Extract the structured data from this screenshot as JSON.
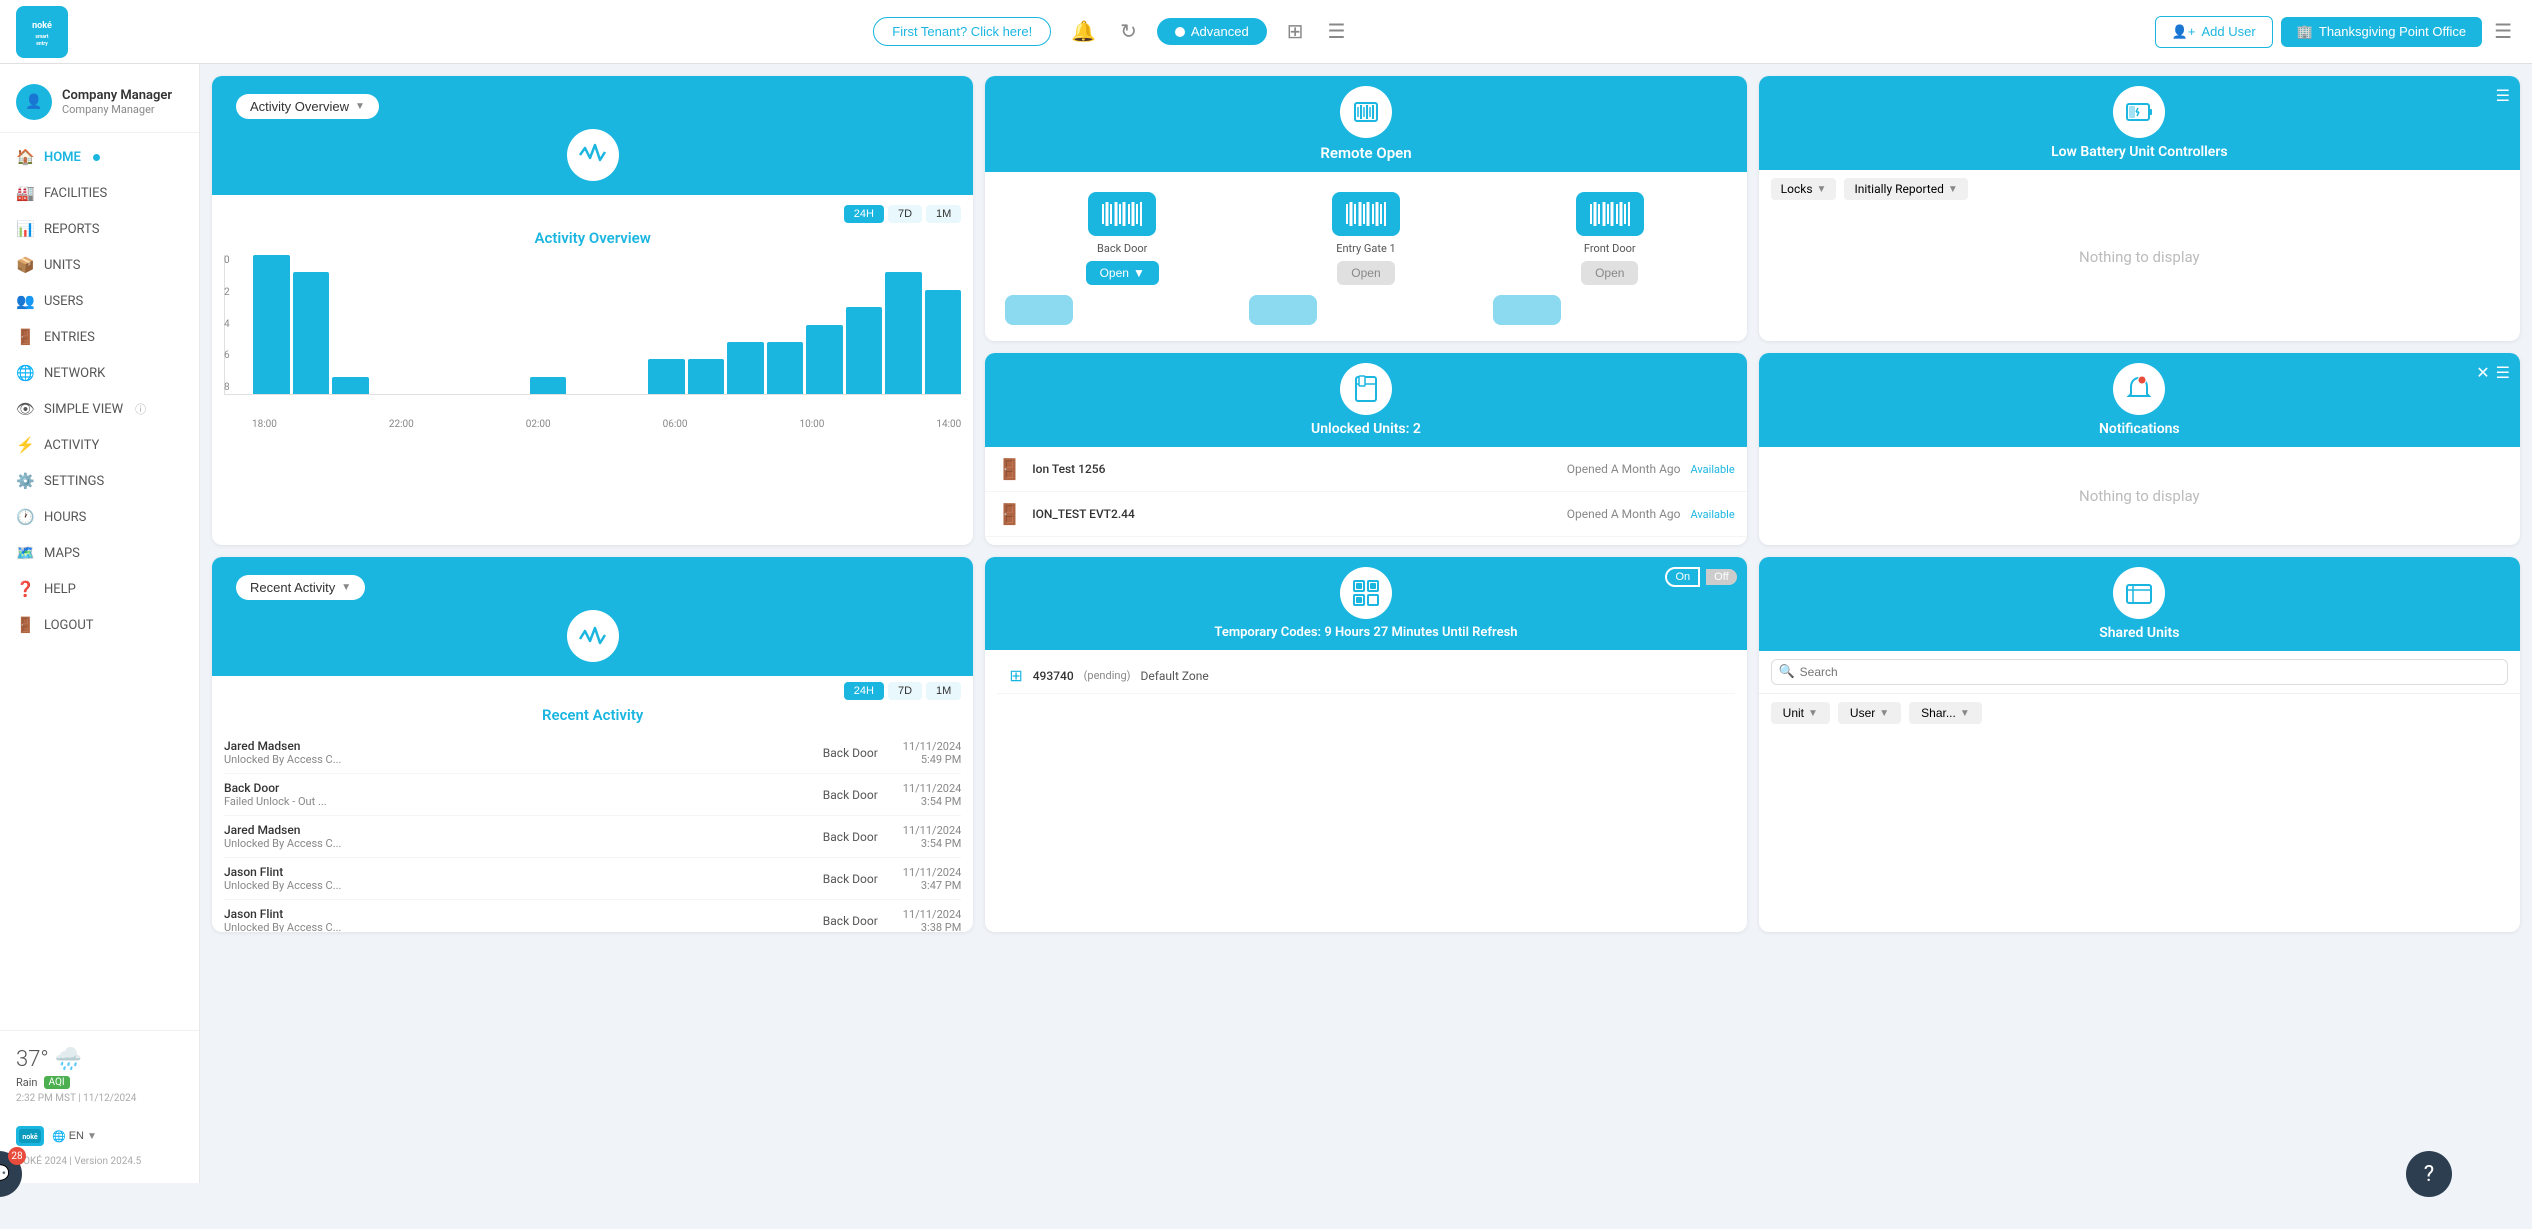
{
  "header": {
    "tenant_btn": "First Tenant? Click here!",
    "advanced_btn": "Advanced",
    "add_user_btn": "Add User",
    "office_btn": "Thanksgiving Point Office"
  },
  "sidebar": {
    "user": {
      "name": "Company Manager",
      "role": "Company Manager"
    },
    "items": [
      {
        "id": "home",
        "label": "HOME",
        "active": true
      },
      {
        "id": "facilities",
        "label": "FACILITIES"
      },
      {
        "id": "reports",
        "label": "REPORTS"
      },
      {
        "id": "units",
        "label": "UNITS"
      },
      {
        "id": "users",
        "label": "USERS"
      },
      {
        "id": "entries",
        "label": "ENTRIES"
      },
      {
        "id": "network",
        "label": "NETWORK"
      },
      {
        "id": "simple_view",
        "label": "SIMPLE VIEW"
      },
      {
        "id": "activity",
        "label": "ACTIVITY"
      },
      {
        "id": "settings",
        "label": "SETTINGS"
      },
      {
        "id": "hours",
        "label": "HOURS"
      },
      {
        "id": "maps",
        "label": "MAPS"
      },
      {
        "id": "help",
        "label": "HELP"
      },
      {
        "id": "logout",
        "label": "LOGOUT"
      }
    ],
    "weather": {
      "temp": "37°",
      "condition": "Rain",
      "aqi": "AQI",
      "datetime": "2:32 PM MST | 11/12/2024"
    },
    "footer": {
      "lang": "EN",
      "version": "NOKÉ 2024 | Version 2024.5"
    }
  },
  "activity_overview": {
    "title": "Activity Overview",
    "dropdown_label": "Activity Overview",
    "time_btns": [
      "24H",
      "7D",
      "1M"
    ],
    "active_time": "24H",
    "chart": {
      "y_labels": [
        "8",
        "6",
        "4",
        "2",
        "0"
      ],
      "x_labels": [
        "18:00",
        "22:00",
        "02:00",
        "06:00",
        "10:00",
        "14:00"
      ],
      "bars": [
        8,
        7,
        1,
        0,
        0,
        0,
        0,
        1,
        0,
        0,
        2,
        2,
        3,
        3,
        4,
        5,
        7,
        6
      ]
    }
  },
  "recent_activity": {
    "title": "Recent Activity",
    "dropdown_label": "Recent Activity",
    "time_btns": [
      "24H",
      "7D",
      "1M"
    ],
    "active_time": "24H",
    "items": [
      {
        "name": "Jared Madsen",
        "desc": "Unlocked By Access C...",
        "door": "Back Door",
        "date": "11/11/2024",
        "time": "5:49 PM"
      },
      {
        "name": "Back Door",
        "desc": "Failed Unlock - Out ...",
        "door": "Back Door",
        "date": "11/11/2024",
        "time": "3:54 PM"
      },
      {
        "name": "Jared Madsen",
        "desc": "Unlocked By Access C...",
        "door": "Back Door",
        "date": "11/11/2024",
        "time": "3:54 PM"
      },
      {
        "name": "Jason Flint",
        "desc": "Unlocked By Access C...",
        "door": "Back Door",
        "date": "11/11/2024",
        "time": "3:47 PM"
      },
      {
        "name": "Jason Flint",
        "desc": "Unlocked By Access C...",
        "door": "Back Door",
        "date": "11/11/2024",
        "time": "3:38 PM"
      }
    ]
  },
  "remote_open": {
    "title": "Remote Open",
    "locks": [
      {
        "name": "Back Door",
        "open_active": true
      },
      {
        "name": "Entry Gate 1",
        "open_active": false
      },
      {
        "name": "Front Door",
        "open_active": false
      }
    ]
  },
  "low_battery": {
    "title": "Low Battery Unit Controllers",
    "filter1": "Locks",
    "filter2": "Initially Reported",
    "nothing": "Nothing to display"
  },
  "unlocked_units": {
    "title": "Unlocked Units: 2",
    "units": [
      {
        "name": "Ion Test 1256",
        "time": "Opened A Month Ago",
        "status": "Available"
      },
      {
        "name": "ION_TEST EVT2.44",
        "time": "Opened A Month Ago",
        "status": "Available"
      }
    ]
  },
  "notifications": {
    "title": "Notifications",
    "nothing": "Nothing to display"
  },
  "temp_codes": {
    "title": "Temporary Codes: 9 Hours 27 Minutes Until Refresh",
    "toggle_on": "On",
    "toggle_off": "Off",
    "codes": [
      {
        "code": "493740",
        "label": "(pending)",
        "zone": "Default Zone"
      }
    ]
  },
  "shared_units": {
    "title": "Shared Units",
    "search_placeholder": "Search",
    "filter1": "Unit",
    "filter2": "User",
    "filter3": "Shar..."
  },
  "chat": {
    "badge": "28"
  }
}
